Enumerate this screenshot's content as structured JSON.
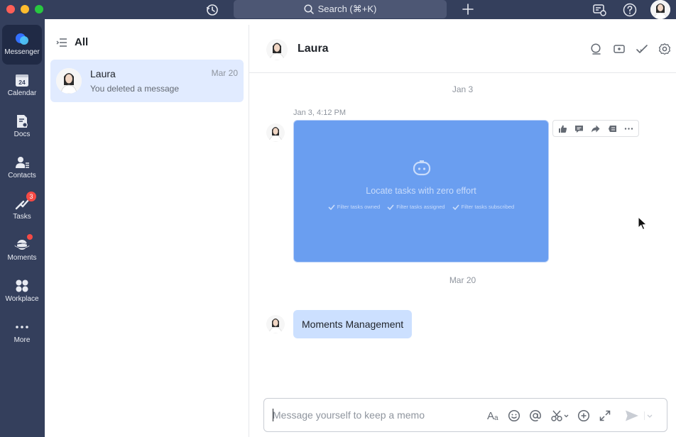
{
  "titlebar": {
    "search_label": "Search (⌘+K)"
  },
  "sidebar": {
    "items": [
      {
        "label": "Messenger",
        "icon": "messenger-icon"
      },
      {
        "label": "Calendar",
        "icon": "calendar-icon",
        "icon_text": "24"
      },
      {
        "label": "Docs",
        "icon": "docs-icon"
      },
      {
        "label": "Contacts",
        "icon": "contacts-icon"
      },
      {
        "label": "Tasks",
        "icon": "tasks-icon",
        "badge": "3"
      },
      {
        "label": "Moments",
        "icon": "moments-icon"
      },
      {
        "label": "Workplace",
        "icon": "workplace-icon"
      },
      {
        "label": "More",
        "icon": "more-icon"
      }
    ]
  },
  "chatlist": {
    "header": "All",
    "items": [
      {
        "name": "Laura",
        "date": "Mar 20",
        "preview": "You deleted a message"
      }
    ]
  },
  "conversation": {
    "title": "Laura",
    "date_separators": [
      "Jan 3",
      "Mar 20"
    ],
    "image_message": {
      "time": "Jan 3, 4:12 PM",
      "caption": "Locate tasks with zero effort",
      "filters": [
        "Filter tasks owned",
        "Filter tasks assigned",
        "Filter tasks subscribed"
      ]
    },
    "text_message": "Moments Management"
  },
  "composer": {
    "placeholder": "Message yourself to keep a memo"
  },
  "colors": {
    "sidebar_bg": "#343f5c",
    "active_nav": "#202a45",
    "selected_chat": "#e1ebff",
    "bubble": "#cce0ff",
    "image_bg": "#6a9ef0",
    "badge": "#f54a45"
  }
}
